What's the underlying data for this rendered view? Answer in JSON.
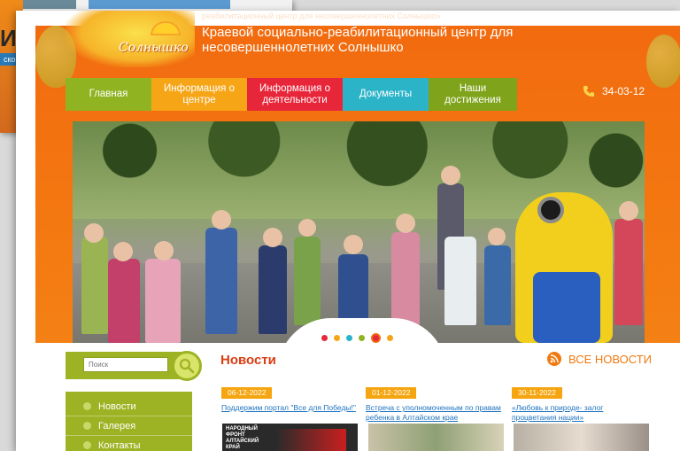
{
  "background_slide": {
    "title_fragment": "ИК",
    "subtitle_fragment": "ской"
  },
  "header": {
    "logo_text": "Солнышко",
    "small_text": "реабилитационный центр для несовершеннолетних Солнышко»",
    "title": "Краевой социально-реабилитационный центр для несовершеннолетних Солнышко"
  },
  "nav": {
    "items": [
      {
        "label": "Главная",
        "color": "#8fb321"
      },
      {
        "label": "Информация о центре",
        "color": "#f6a516"
      },
      {
        "label": "Информация о деятельности",
        "color": "#e8263a"
      },
      {
        "label": "Документы",
        "color": "#2bb3c8"
      },
      {
        "label": "Наши достижения",
        "color": "#7fa31a"
      }
    ],
    "phone": "34-03-12"
  },
  "slider": {
    "dots": [
      {
        "color": "#e8263a"
      },
      {
        "color": "#f6a516"
      },
      {
        "color": "#2bb3c8"
      },
      {
        "color": "#8fb321"
      },
      {
        "color": "#e8263a",
        "active": true
      },
      {
        "color": "#f6a516"
      }
    ]
  },
  "search": {
    "placeholder": "Поиск"
  },
  "side_menu": {
    "items": [
      {
        "label": "Новости"
      },
      {
        "label": "Галерея"
      },
      {
        "label": "Контакты"
      }
    ]
  },
  "news": {
    "heading": "Новости",
    "all_label": "ВСЕ НОВОСТИ",
    "items": [
      {
        "date": "06-12-2022",
        "title": "Поддержим портал \"Все для Победы!\"",
        "thumb_text": "НАРОДНЫЙ ФРОНТ АЛТАЙСКИЙ КРАЙ"
      },
      {
        "date": "01-12-2022",
        "title": "Встреча с уполномоченным по правам ребенка в Алтайском крае"
      },
      {
        "date": "30-11-2022",
        "title": "«Любовь к природе- залог процветания нации»"
      }
    ]
  }
}
